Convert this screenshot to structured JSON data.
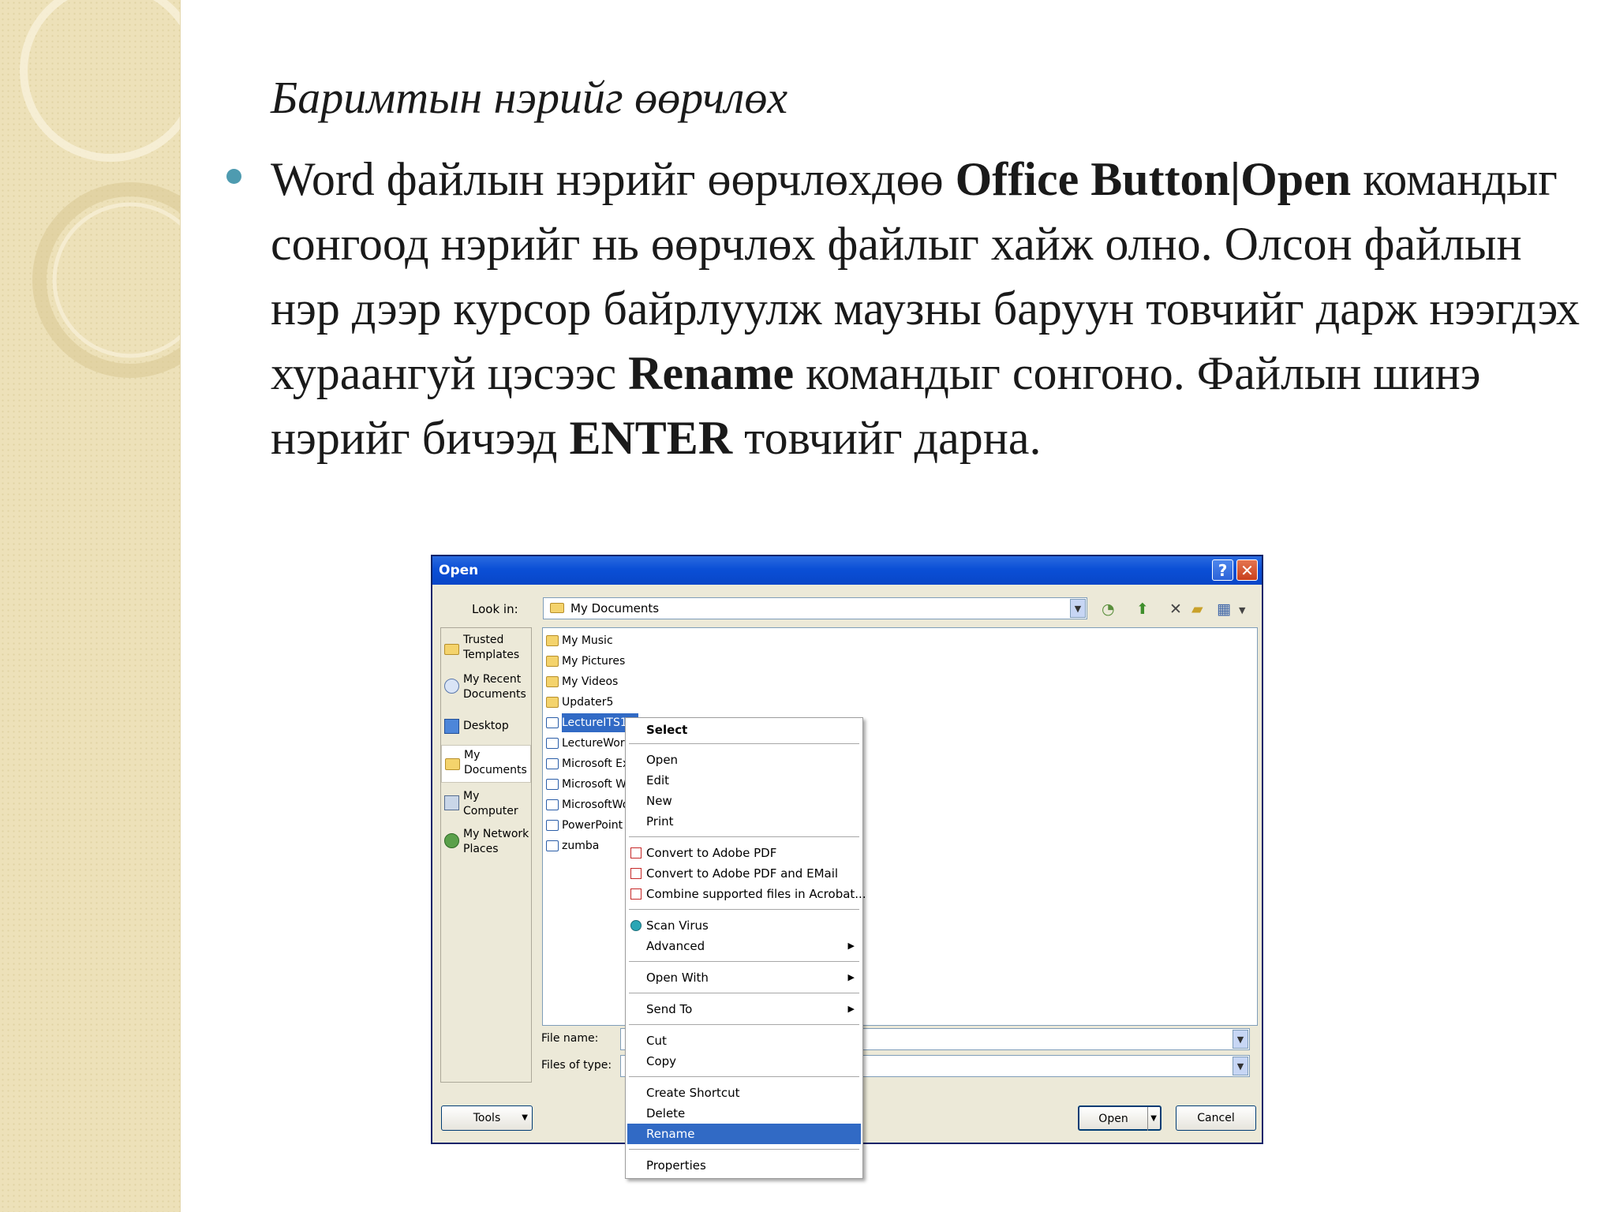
{
  "slide": {
    "title": "Баримтын нэрийг өөрчлөх",
    "bullet": {
      "t1": "Word файлын нэрийг өөрчлөхдөө ",
      "b1": "Office Button|Open",
      "t2": " командыг сонгоод нэрийг нь өөрчлөх файлыг хайж олно. Олсон файлын нэр дээр курсор байрлуулж маузны баруун товчийг дарж нээгдэх хураангуй цэсээс ",
      "b2": "Rename",
      "t3": " командыг сонгоно. Файлын шинэ нэрийг бичээд  ",
      "b3": "ENTER",
      "t4": " товчийг дарна."
    }
  },
  "dialog": {
    "title": "Open",
    "help_label": "?",
    "close_label": "✕",
    "look_in_label": "Look in:",
    "look_in_value": "My Documents",
    "file_name_label": "File name:",
    "files_of_type_label": "Files of type:",
    "tools_label": "Tools",
    "open_label": "Open",
    "cancel_label": "Cancel",
    "places": [
      {
        "l1": "Trusted",
        "l2": "Templates",
        "icon": "folder-icon"
      },
      {
        "l1": "My Recent",
        "l2": "Documents",
        "icon": "recent-documents-icon"
      },
      {
        "l1": "Desktop",
        "l2": "",
        "icon": "desktop-icon"
      },
      {
        "l1": "My",
        "l2": "Documents",
        "icon": "my-documents-icon"
      },
      {
        "l1": "My",
        "l2": "Computer",
        "icon": "computer-icon"
      },
      {
        "l1": "My Network",
        "l2": "Places",
        "icon": "network-icon"
      }
    ],
    "files": [
      {
        "name": "My Music",
        "kind": "folder"
      },
      {
        "name": "My Pictures",
        "kind": "folder"
      },
      {
        "name": "My Videos",
        "kind": "folder"
      },
      {
        "name": "Updater5",
        "kind": "folder"
      },
      {
        "name": "LectureITS1",
        "kind": "word"
      },
      {
        "name": "LectureWor",
        "kind": "word"
      },
      {
        "name": "Microsoft Ex",
        "kind": "word"
      },
      {
        "name": "Microsoft W",
        "kind": "word"
      },
      {
        "name": "MicrosoftWo",
        "kind": "word"
      },
      {
        "name": "PowerPoint",
        "kind": "word"
      },
      {
        "name": "zumba",
        "kind": "word"
      }
    ]
  },
  "context_menu": {
    "select": "Select",
    "open": "Open",
    "edit": "Edit",
    "new": "New",
    "print": "Print",
    "convert_pdf": "Convert to Adobe PDF",
    "convert_pdf_email": "Convert to Adobe PDF and EMail",
    "combine": "Combine supported files in Acrobat...",
    "scan_virus": "Scan Virus",
    "advanced": "Advanced",
    "open_with": "Open With",
    "send_to": "Send To",
    "cut": "Cut",
    "copy": "Copy",
    "create_shortcut": "Create Shortcut",
    "delete": "Delete",
    "rename": "Rename",
    "properties": "Properties"
  },
  "colors": {
    "bullet": "#4e9bb0",
    "sidebar": "#ede1b9",
    "highlight": "#316ac5",
    "titlebar": "#0b4fd6"
  }
}
